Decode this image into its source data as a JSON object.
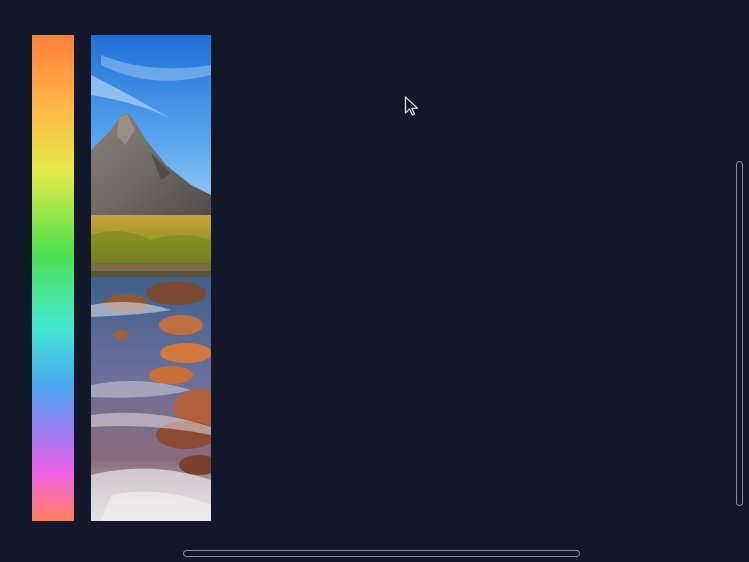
{
  "canvas": {
    "background": "#12172a"
  },
  "hue_strip": {
    "colors": [
      "#ff7f3c",
      "#ffb347",
      "#e6ea4a",
      "#4ee04e",
      "#45e8d2",
      "#4aa8f0",
      "#a07cf0",
      "#f062e8",
      "#ff7f5a"
    ]
  },
  "photo": {
    "subject": "mountain-river-landscape"
  },
  "cursor": {
    "icon": "arrow-cursor-icon"
  },
  "scrollbars": {
    "vertical": "vertical-scrollbar",
    "horizontal": "horizontal-scrollbar"
  }
}
